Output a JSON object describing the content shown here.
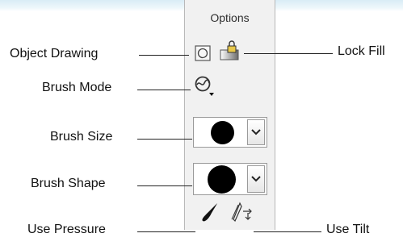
{
  "panel": {
    "title": "Options"
  },
  "callouts": {
    "object_drawing": "Object Drawing",
    "brush_mode": "Brush Mode",
    "brush_size": "Brush Size",
    "brush_shape": "Brush Shape",
    "use_pressure": "Use Pressure",
    "lock_fill": "Lock Fill",
    "use_tilt": "Use Tilt"
  },
  "icons": {
    "object_drawing": "object-drawing-icon",
    "lock_fill": "lock-fill-icon",
    "brush_mode": "brush-mode-icon",
    "use_pressure": "pressure-brush-icon",
    "use_tilt": "tilt-pen-icon"
  },
  "colors": {
    "panel_bg": "#f1f1f1",
    "border": "#9a9a9a",
    "callout_line": "#222222"
  }
}
